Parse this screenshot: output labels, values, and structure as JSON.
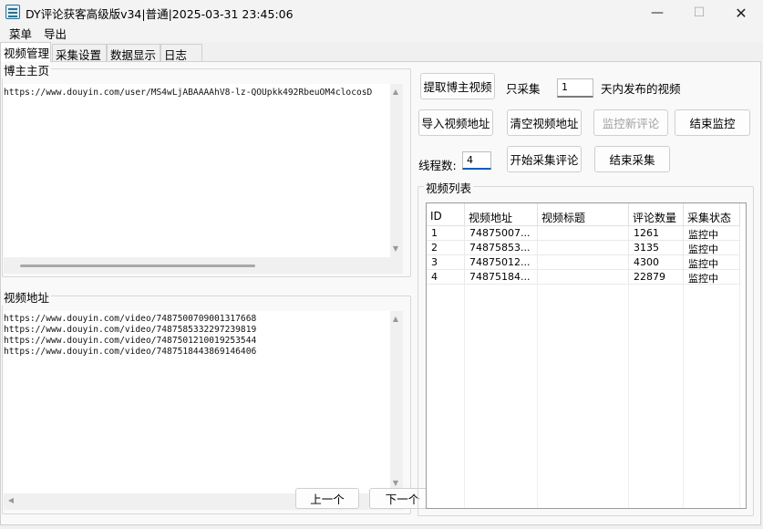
{
  "window": {
    "title": "DY评论获客高级版v34|普通|2025-03-31 23:45:06",
    "minimize_glyph": "—",
    "maximize_glyph": "☐",
    "close_glyph": "✕"
  },
  "menu": [
    "菜单",
    "导出"
  ],
  "tabs": [
    "视频管理",
    "采集设置",
    "数据显示",
    "日志"
  ],
  "blogger": {
    "label": "博主主页",
    "url": "https://www.douyin.com/user/MS4wLjABAAAAhV8-lz-QOUpkk492RbeuOM4clocosD"
  },
  "video_address": {
    "label": "视频地址",
    "lines": [
      "https://www.douyin.com/video/7487500709001317668",
      "https://www.douyin.com/video/7487585332297239819",
      "https://www.douyin.com/video/7487501210019253544",
      "https://www.douyin.com/video/7487518443869146406"
    ]
  },
  "controls": {
    "fetch_button": "提取博主视频",
    "only_collect_label": "只采集",
    "days_value": "1",
    "days_suffix": "天内发布的视频",
    "import_button": "导入视频地址",
    "clear_button": "清空视频地址",
    "monitor_button": "监控新评论",
    "end_monitor_button": "结束监控",
    "threads_label": "线程数:",
    "threads_value": "4",
    "start_button": "开始采集评论",
    "end_collect_button": "结束采集"
  },
  "video_list": {
    "label": "视频列表",
    "columns": [
      "ID",
      "视频地址",
      "视频标题",
      "评论数量",
      "采集状态"
    ],
    "rows": [
      [
        "1",
        "74875007...",
        "",
        "1261",
        "监控中"
      ],
      [
        "2",
        "74875853...",
        "",
        "3135",
        "监控中"
      ],
      [
        "3",
        "74875012...",
        "",
        "4300",
        "监控中"
      ],
      [
        "4",
        "74875184...",
        "",
        "22879",
        "监控中"
      ]
    ]
  },
  "pager": {
    "prev": "上一个",
    "next": "下一个"
  },
  "scroll_arrows": {
    "up": "▲",
    "down": "▼",
    "left": "◀"
  }
}
